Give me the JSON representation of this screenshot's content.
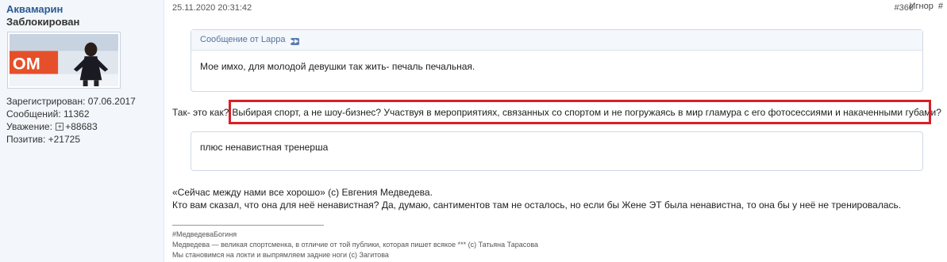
{
  "user": {
    "name": "Аквамарин",
    "title": "Заблокирован",
    "avatar_text": "ОМ",
    "stats": {
      "registered_label": "Зарегистрирован:",
      "registered_value": "07.06.2017",
      "messages_label": "Сообщений:",
      "messages_value": "11362",
      "respect_label": "Уважение:",
      "respect_value": "+88683",
      "positive_label": "Позитив:",
      "positive_value": "+21725"
    }
  },
  "post": {
    "date": "25.11.2020 20:31:42",
    "number": "#360",
    "ignore_label": "Игнор",
    "hash": "#",
    "quote": {
      "header": "Сообщение от Lappa",
      "text": "Мое имхо, для молодой девушки так жить- печаль печальная."
    },
    "reply_prefix": "Так- это как?",
    "reply_highlight": "Выбирая спорт, а не шоу-бизнес? Участвуя в мероприятиях, связанных со спортом и не погружаясь в мир гламура с его фотосессиями и накаченными губами?",
    "quote2": {
      "text": "плюс ненавистная тренерша"
    },
    "paragraph1": "«Сейчас между нами все хорошо» (с) Евгения Медведева.",
    "paragraph2": "Кто вам сказал, что она для неё ненавистная? Да, думаю, сантиментов там не осталось, но если бы Жене ЭТ была ненавистна, то она бы у неё не тренировалась.",
    "signature": [
      "#МедведеваБогиня",
      "Медведева — великая спортсменка, в отличие от той публики, которая пишет всякое *** (с) Татьяна Тарасова",
      "Мы становимся на локти и выпрямляем задние ноги (с) Загитова"
    ]
  },
  "colors": {
    "accent": "#2a5b92",
    "highlight_border": "#d91f26",
    "sidebar_bg": "#f3f6fa"
  }
}
